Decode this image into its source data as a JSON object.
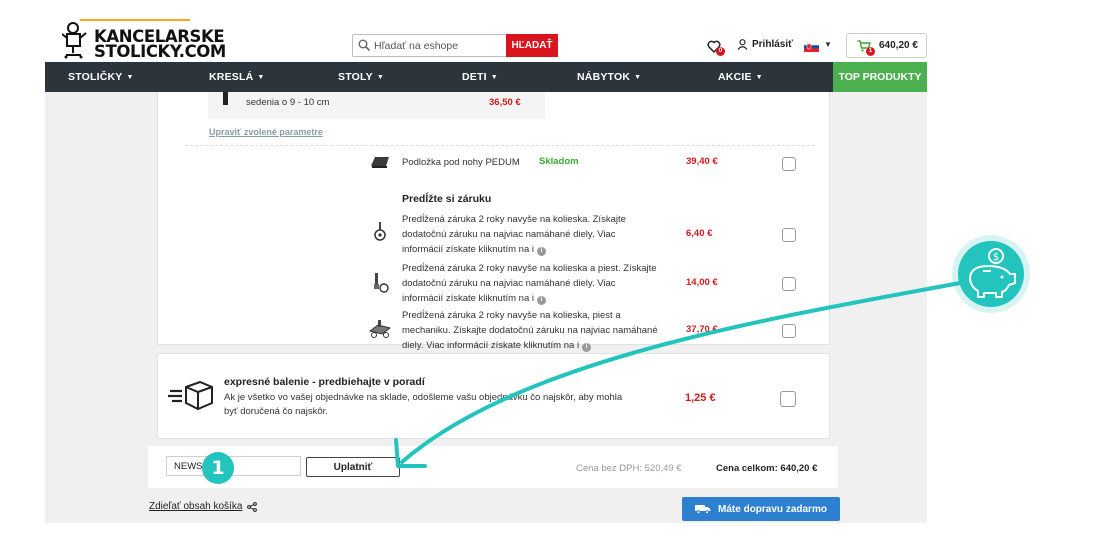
{
  "brand": {
    "line1": "KANCELARSKE",
    "line2": "STOLICKY.COM"
  },
  "header": {
    "search_placeholder": "Hľadať na eshope",
    "search_button": "HĽADAŤ",
    "wishlist_count": "0",
    "login_label": "Prihlásiť",
    "cart_count": "1",
    "cart_amount": "640,20 €"
  },
  "nav": {
    "items": [
      "STOLIČKY",
      "KRESLÁ",
      "STOLY",
      "DETI",
      "NÁBYTOK",
      "AKCIE"
    ],
    "top_products": "TOP PRODUKTY"
  },
  "config": {
    "row_text": "sedenia o 9 - 10 cm",
    "row_price": "36,50 €",
    "edit_link": "Upraviť zvolené parametre"
  },
  "accessory": {
    "name": "Podložka pod nohy PEDUM",
    "stock": "Skladom",
    "price": "39,40 €"
  },
  "warranty": {
    "title": "Predĺžte si záruku",
    "items": [
      {
        "line1": "Predĺžená záruka 2 roky navyše na kolieska. Získajte",
        "line2": "dodatočnú záruku na najviac namáhané diely. Viac",
        "line3": "informácií získate kliknutím na i",
        "price": "6,40 €"
      },
      {
        "line1": "Predĺžená záruka 2 roky navyše na kolieska a piest. Získajte",
        "line2": "dodatočnú záruku na najviac namáhané diely. Viac",
        "line3": "informácií získate kliknutím na i",
        "price": "14,00 €"
      },
      {
        "line1": "Predĺžená záruka 2 roky navyše na kolieska, piest a",
        "line2": "mechaniku. Získajte dodatočnú záruku na najviac namáhané",
        "line3": "diely. Viac informácií získate kliknutím na i",
        "price": "37,70 €"
      }
    ]
  },
  "packaging": {
    "title": "expresné balenie - predbiehajte v poradí",
    "desc_line1": "Ak je všetko vo vašej objednávke na sklade, odošleme vašu objednávku čo najskôr, aby mohla",
    "desc_line2": "byť doručená čo najskôr.",
    "price": "1,25 €"
  },
  "summary": {
    "coupon_value": "NEWS",
    "apply_button": "Uplatniť",
    "net_label": "Cena bez DPH: 520,49 €",
    "total_label": "Cena celkom: 640,20 €"
  },
  "footer": {
    "share_link": "Zdieľať obsah košíka",
    "shipping_badge": "Máte dopravu zadarmo"
  },
  "annotation": {
    "step_number": "1",
    "accent_color": "#23c4bd"
  },
  "colors": {
    "nav_bg": "#2c343c",
    "top_products_bg": "#4caf50",
    "price_red": "#cc1d1d",
    "stock_green": "#3aa935",
    "shipping_blue": "#2d7fd0",
    "search_red": "#d9141f"
  }
}
